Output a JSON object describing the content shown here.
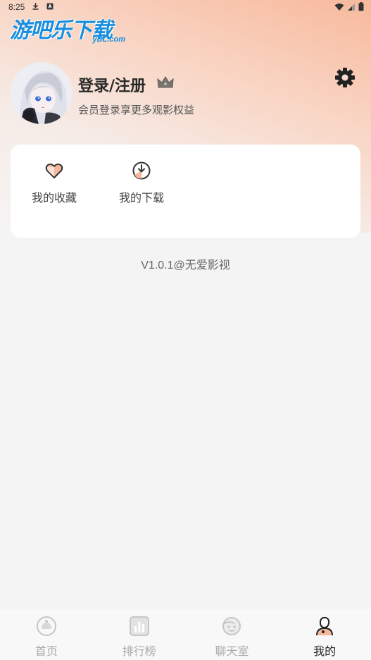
{
  "status_bar": {
    "time": "8:25"
  },
  "watermark": {
    "main": "游吧乐下载",
    "sub": "yBL.com"
  },
  "profile": {
    "title": "登录/注册",
    "subtitle": "会员登录享更多观影权益"
  },
  "shortcuts": [
    {
      "label": "我的收藏",
      "icon": "heart-icon"
    },
    {
      "label": "我的下载",
      "icon": "download-icon"
    }
  ],
  "version_text": "V1.0.1@无爱影视",
  "tabs": [
    {
      "label": "首页",
      "icon": "home-icon",
      "active": false
    },
    {
      "label": "排行榜",
      "icon": "ranking-icon",
      "active": false
    },
    {
      "label": "聊天室",
      "icon": "chat-icon",
      "active": false
    },
    {
      "label": "我的",
      "icon": "profile-icon",
      "active": true
    }
  ],
  "colors": {
    "accent": "#f08a5d",
    "background": "#f5f4f4",
    "watermark": "#1a8fe0"
  }
}
